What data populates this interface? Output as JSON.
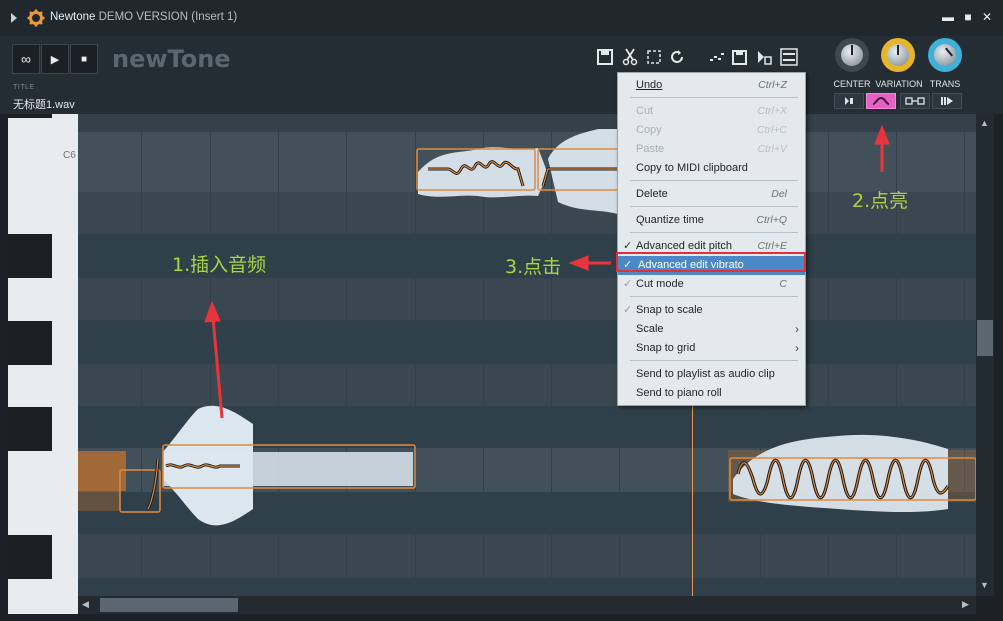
{
  "titlebar": {
    "app_name": "Newtone",
    "subtitle": "DEMO VERSION (Insert 1)",
    "minimize": "▬",
    "maximize": "■",
    "close": "✕"
  },
  "transport": {
    "loop": "∞",
    "play": "▶",
    "stop": "■"
  },
  "logo": "newTone",
  "file": {
    "title_label": "TITLE",
    "name": "无标题1.wav"
  },
  "knobs": [
    {
      "label": "CENTER"
    },
    {
      "label": "VARIATION"
    },
    {
      "label": "TRANS"
    }
  ],
  "piano": {
    "c6_label": "C6"
  },
  "context_menu": {
    "items": [
      {
        "label": "Undo",
        "shortcut": "Ctrl+Z",
        "enabled": true
      },
      {
        "label": "Cut",
        "shortcut": "Ctrl+X",
        "enabled": false
      },
      {
        "label": "Copy",
        "shortcut": "Ctrl+C",
        "enabled": false
      },
      {
        "label": "Paste",
        "shortcut": "Ctrl+V",
        "enabled": false
      },
      {
        "label": "Copy to MIDI clipboard",
        "shortcut": "",
        "enabled": true
      },
      {
        "label": "Delete",
        "shortcut": "Del",
        "enabled": true
      },
      {
        "label": "Quantize time",
        "shortcut": "Ctrl+Q",
        "enabled": true
      },
      {
        "label": "Advanced edit pitch",
        "shortcut": "Ctrl+E",
        "enabled": true,
        "checked": true
      },
      {
        "label": "Advanced edit vibrato",
        "shortcut": "",
        "enabled": true,
        "checked": true
      },
      {
        "label": "Cut mode",
        "shortcut": "C",
        "enabled": true,
        "checked": true
      },
      {
        "label": "Snap to scale",
        "shortcut": "",
        "enabled": true,
        "checked": true
      },
      {
        "label": "Scale",
        "shortcut": "",
        "enabled": true,
        "submenu": true
      },
      {
        "label": "Snap to grid",
        "shortcut": "",
        "enabled": true,
        "submenu": true
      },
      {
        "label": "Send to playlist as audio clip",
        "shortcut": "",
        "enabled": true
      },
      {
        "label": "Send to piano roll",
        "shortcut": "",
        "enabled": true
      }
    ]
  },
  "annotations": {
    "step1": "1.插入音频",
    "step2": "2.点亮",
    "step3": "3.点击",
    "color": "#a8d640",
    "arrow_color": "#e8343c"
  },
  "colors": {
    "accent_orange": "#e08a3c",
    "vibrato_button": "#e85fc8",
    "grid_bg": "#3a4750"
  }
}
